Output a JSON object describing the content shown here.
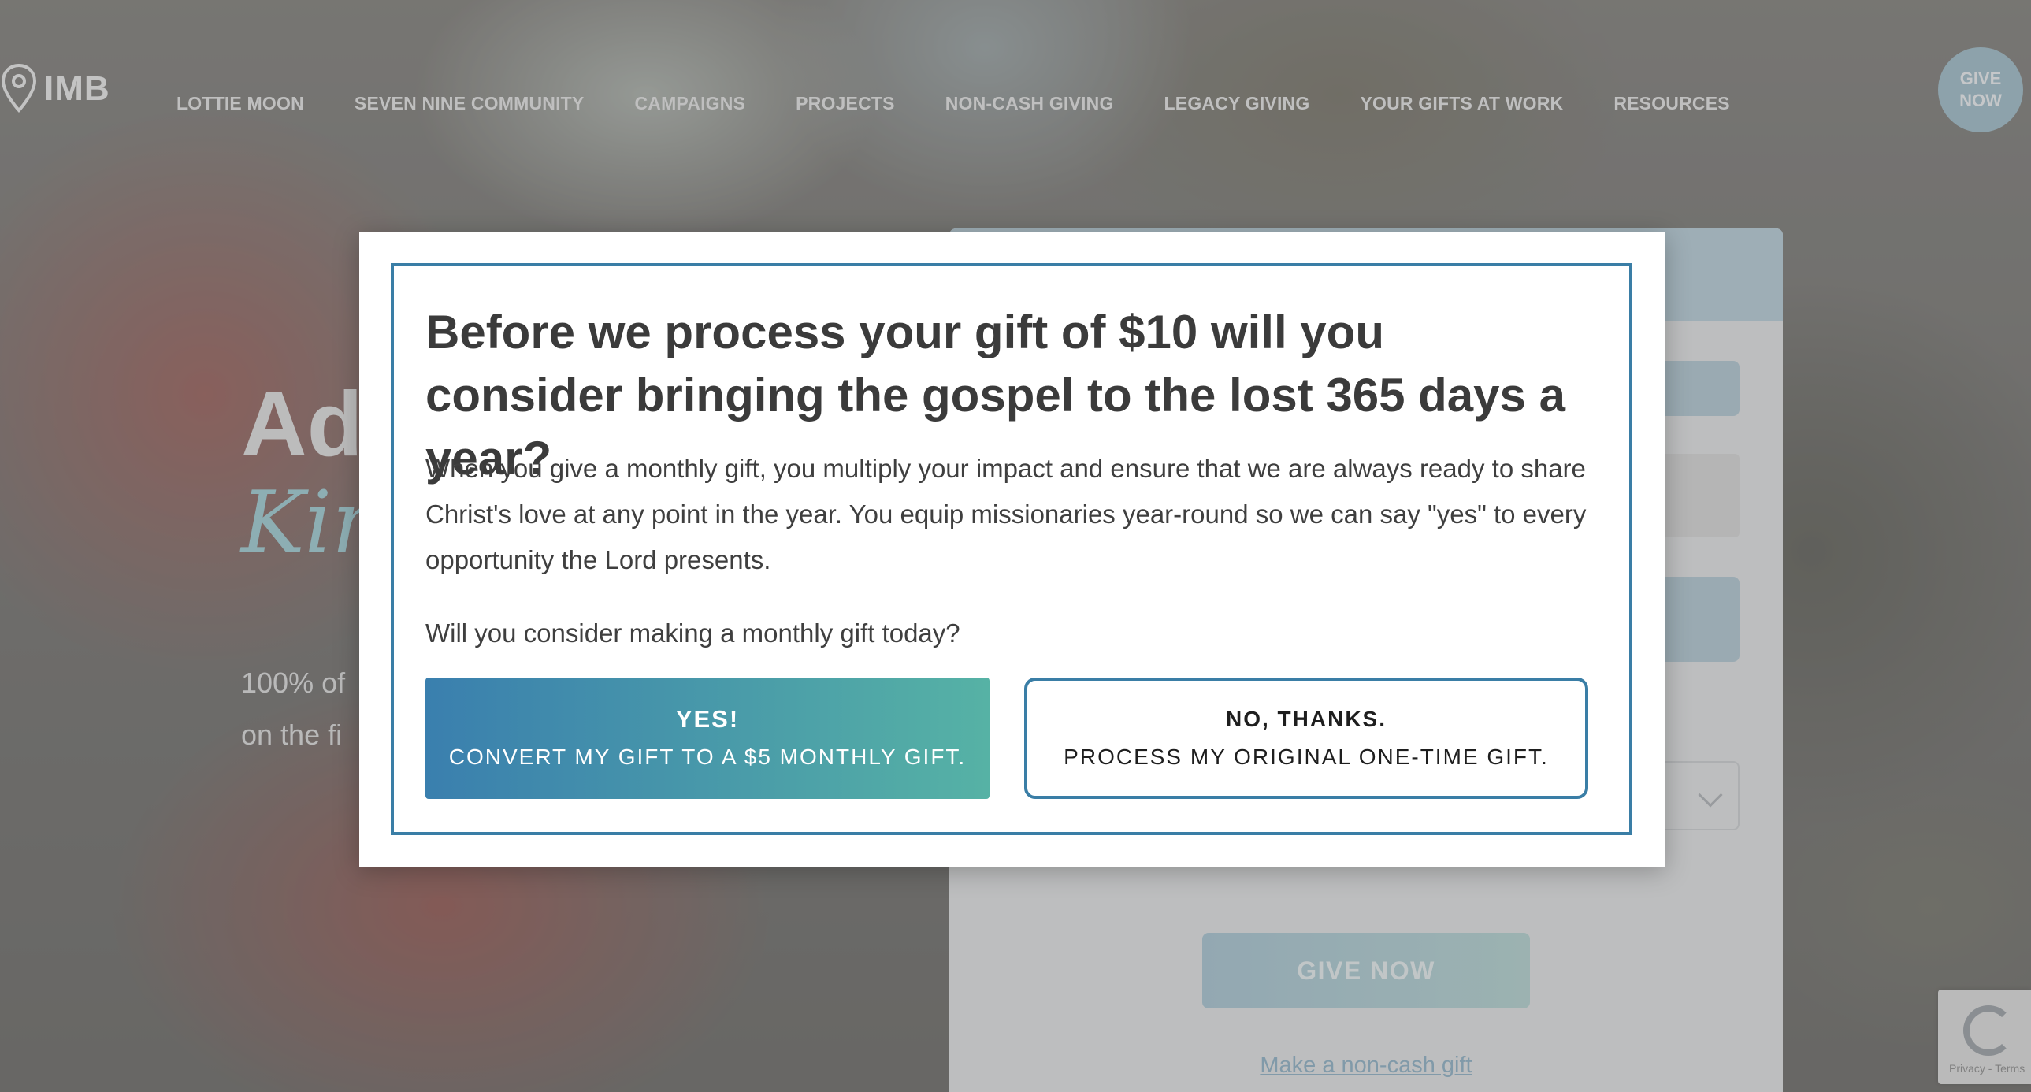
{
  "header": {
    "logo_text": "IMB",
    "nav": [
      {
        "label": "LOTTIE MOON"
      },
      {
        "label": "SEVEN NINE COMMUNITY"
      },
      {
        "label": "CAMPAIGNS"
      },
      {
        "label": "PROJECTS"
      },
      {
        "label": "NON-CASH GIVING"
      },
      {
        "label": "LEGACY GIVING"
      },
      {
        "label": "YOUR GIFTS AT WORK"
      },
      {
        "label": "RESOURCES"
      }
    ],
    "give_now_button": "GIVE\nNOW"
  },
  "hero": {
    "title_visible": "Adv",
    "script_visible": "King",
    "copy_line1_visible": "100% of",
    "copy_line2_visible": "on the fi"
  },
  "form": {
    "give_button": "GIVE NOW",
    "noncash_link": "Make a non-cash gift",
    "recaptcha_text": "Privacy - Terms"
  },
  "modal": {
    "heading": "Before we process your gift of $10 will you consider bringing the gospel to the lost 365 days a year?",
    "body": "When you give a monthly gift, you multiply your impact and ensure that we are always ready to share Christ's love at any point in the year. You equip missionaries year-round so we can say \"yes\" to every opportunity the Lord presents.",
    "question": "Will you consider making a monthly gift today?",
    "yes_button": {
      "line1": "YES!",
      "line2": "CONVERT MY GIFT TO A $5 MONTHLY GIFT."
    },
    "no_button": {
      "line1": "NO, THANKS.",
      "line2": "PROCESS MY ORIGINAL ONE-TIME GIFT."
    }
  },
  "colors": {
    "accent_blue": "#3a7ea6",
    "yes_gradient_start": "#3a7fae",
    "yes_gradient_end": "#56b2a5",
    "heading_text": "#3b3b3b"
  }
}
